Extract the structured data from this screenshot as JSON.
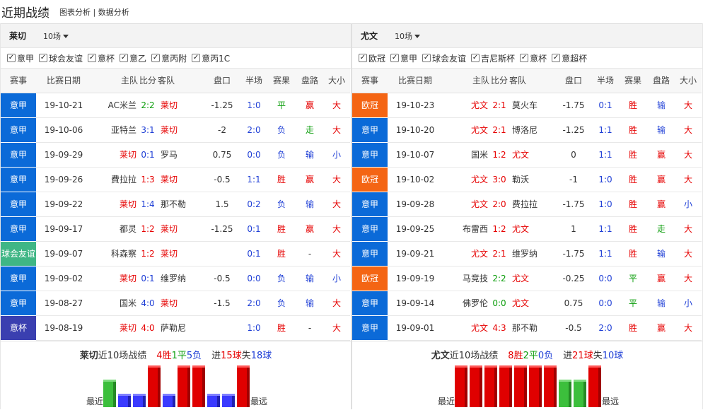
{
  "header": {
    "title": "近期战绩",
    "link1": "图表分析",
    "sep": "|",
    "link2": "数据分析"
  },
  "columns": [
    "赛事",
    "比赛日期",
    "主队",
    "比分",
    "客队",
    "盘口",
    "半场",
    "赛果",
    "盘路",
    "大小"
  ],
  "colors": {
    "league_serie_a": "#0b6ad8",
    "league_ucl": "#f46514",
    "league_friendly": "#3fb685",
    "league_cup": "#3a3fb0",
    "win": "#e60000",
    "draw": "#0a9d0a",
    "loss": "#1f3fd6"
  },
  "left": {
    "team": "莱切",
    "count": "10场",
    "filters": [
      "意甲",
      "球会友谊",
      "意杯",
      "意乙",
      "意丙附",
      "意丙1C"
    ],
    "rows": [
      {
        "league": "意甲",
        "lc": "sa",
        "date": "19-10-21",
        "home": "AC米兰",
        "hr": false,
        "score": "2:2",
        "sc": "g",
        "away": "莱切",
        "ar": true,
        "pk": "-1.25",
        "half": "1:0",
        "res": "平",
        "rc": "g",
        "pan": "赢",
        "pc": "r",
        "ou": "大",
        "oc": "r"
      },
      {
        "league": "意甲",
        "lc": "sa",
        "date": "19-10-06",
        "home": "亚特兰",
        "hr": false,
        "score": "3:1",
        "sc": "b",
        "away": "莱切",
        "ar": true,
        "pk": "-2",
        "half": "2:0",
        "res": "负",
        "rc": "b",
        "pan": "走",
        "pc": "g",
        "ou": "大",
        "oc": "r"
      },
      {
        "league": "意甲",
        "lc": "sa",
        "date": "19-09-29",
        "home": "莱切",
        "hr": true,
        "score": "0:1",
        "sc": "b",
        "away": "罗马",
        "ar": false,
        "pk": "0.75",
        "half": "0:0",
        "res": "负",
        "rc": "b",
        "pan": "输",
        "pc": "b",
        "ou": "小",
        "oc": "b"
      },
      {
        "league": "意甲",
        "lc": "sa",
        "date": "19-09-26",
        "home": "費拉拉",
        "hr": false,
        "score": "1:3",
        "sc": "r",
        "away": "莱切",
        "ar": true,
        "pk": "-0.5",
        "half": "1:1",
        "res": "胜",
        "rc": "r",
        "pan": "赢",
        "pc": "r",
        "ou": "大",
        "oc": "r"
      },
      {
        "league": "意甲",
        "lc": "sa",
        "date": "19-09-22",
        "home": "莱切",
        "hr": true,
        "score": "1:4",
        "sc": "b",
        "away": "那不勒",
        "ar": false,
        "pk": "1.5",
        "half": "0:2",
        "res": "负",
        "rc": "b",
        "pan": "输",
        "pc": "b",
        "ou": "大",
        "oc": "r"
      },
      {
        "league": "意甲",
        "lc": "sa",
        "date": "19-09-17",
        "home": "都灵",
        "hr": false,
        "score": "1:2",
        "sc": "r",
        "away": "莱切",
        "ar": true,
        "pk": "-1.25",
        "half": "0:1",
        "res": "胜",
        "rc": "r",
        "pan": "赢",
        "pc": "r",
        "ou": "大",
        "oc": "r"
      },
      {
        "league": "球会友谊",
        "lc": "fr",
        "date": "19-09-07",
        "home": "科森察",
        "hr": false,
        "score": "1:2",
        "sc": "r",
        "away": "莱切",
        "ar": true,
        "pk": "",
        "half": "0:1",
        "res": "胜",
        "rc": "r",
        "pan": "-",
        "pc": "n",
        "ou": "大",
        "oc": "r"
      },
      {
        "league": "意甲",
        "lc": "sa",
        "date": "19-09-02",
        "home": "莱切",
        "hr": true,
        "score": "0:1",
        "sc": "b",
        "away": "维罗纳",
        "ar": false,
        "pk": "-0.5",
        "half": "0:0",
        "res": "负",
        "rc": "b",
        "pan": "输",
        "pc": "b",
        "ou": "小",
        "oc": "b"
      },
      {
        "league": "意甲",
        "lc": "sa",
        "date": "19-08-27",
        "home": "国米",
        "hr": false,
        "score": "4:0",
        "sc": "b",
        "away": "莱切",
        "ar": true,
        "pk": "-1.5",
        "half": "2:0",
        "res": "负",
        "rc": "b",
        "pan": "输",
        "pc": "b",
        "ou": "大",
        "oc": "r"
      },
      {
        "league": "意杯",
        "lc": "cup",
        "date": "19-08-19",
        "home": "莱切",
        "hr": true,
        "score": "4:0",
        "sc": "r",
        "away": "萨勒尼",
        "ar": false,
        "pk": "",
        "half": "1:0",
        "res": "胜",
        "rc": "r",
        "pan": "-",
        "pc": "n",
        "ou": "大",
        "oc": "r"
      }
    ],
    "summary": {
      "team": "莱切",
      "label": "近10场战绩",
      "w": "4胜",
      "d": "1平",
      "l": "5负",
      "g1": "进",
      "gf": "15球",
      "g2": "失",
      "ga": "18球"
    },
    "form": [
      "d",
      "l",
      "l",
      "w",
      "l",
      "w",
      "w",
      "l",
      "l",
      "w"
    ],
    "recent": "最近",
    "far": "最远"
  },
  "right": {
    "team": "尤文",
    "count": "10场",
    "filters": [
      "欧冠",
      "意甲",
      "球会友谊",
      "吉尼斯杯",
      "意杯",
      "意超杯"
    ],
    "rows": [
      {
        "league": "欧冠",
        "lc": "ucl",
        "date": "19-10-23",
        "home": "尤文",
        "hr": true,
        "score": "2:1",
        "sc": "r",
        "away": "莫火车",
        "ar": false,
        "pk": "-1.75",
        "half": "0:1",
        "res": "胜",
        "rc": "r",
        "pan": "输",
        "pc": "b",
        "ou": "大",
        "oc": "r"
      },
      {
        "league": "意甲",
        "lc": "sa",
        "date": "19-10-20",
        "home": "尤文",
        "hr": true,
        "score": "2:1",
        "sc": "r",
        "away": "博洛尼",
        "ar": false,
        "pk": "-1.25",
        "half": "1:1",
        "res": "胜",
        "rc": "r",
        "pan": "输",
        "pc": "b",
        "ou": "大",
        "oc": "r"
      },
      {
        "league": "意甲",
        "lc": "sa",
        "date": "19-10-07",
        "home": "国米",
        "hr": false,
        "score": "1:2",
        "sc": "r",
        "away": "尤文",
        "ar": true,
        "pk": "0",
        "half": "1:1",
        "res": "胜",
        "rc": "r",
        "pan": "赢",
        "pc": "r",
        "ou": "大",
        "oc": "r"
      },
      {
        "league": "欧冠",
        "lc": "ucl",
        "date": "19-10-02",
        "home": "尤文",
        "hr": true,
        "score": "3:0",
        "sc": "r",
        "away": "勒沃",
        "ar": false,
        "pk": "-1",
        "half": "1:0",
        "res": "胜",
        "rc": "r",
        "pan": "赢",
        "pc": "r",
        "ou": "大",
        "oc": "r"
      },
      {
        "league": "意甲",
        "lc": "sa",
        "date": "19-09-28",
        "home": "尤文",
        "hr": true,
        "score": "2:0",
        "sc": "r",
        "away": "费拉拉",
        "ar": false,
        "pk": "-1.75",
        "half": "1:0",
        "res": "胜",
        "rc": "r",
        "pan": "赢",
        "pc": "r",
        "ou": "小",
        "oc": "b"
      },
      {
        "league": "意甲",
        "lc": "sa",
        "date": "19-09-25",
        "home": "布雷西",
        "hr": false,
        "score": "1:2",
        "sc": "r",
        "away": "尤文",
        "ar": true,
        "pk": "1",
        "half": "1:1",
        "res": "胜",
        "rc": "r",
        "pan": "走",
        "pc": "g",
        "ou": "大",
        "oc": "r"
      },
      {
        "league": "意甲",
        "lc": "sa",
        "date": "19-09-21",
        "home": "尤文",
        "hr": true,
        "score": "2:1",
        "sc": "r",
        "away": "维罗纳",
        "ar": false,
        "pk": "-1.75",
        "half": "1:1",
        "res": "胜",
        "rc": "r",
        "pan": "输",
        "pc": "b",
        "ou": "大",
        "oc": "r"
      },
      {
        "league": "欧冠",
        "lc": "ucl",
        "date": "19-09-19",
        "home": "马竞技",
        "hr": false,
        "score": "2:2",
        "sc": "g",
        "away": "尤文",
        "ar": true,
        "pk": "-0.25",
        "half": "0:0",
        "res": "平",
        "rc": "g",
        "pan": "赢",
        "pc": "r",
        "ou": "大",
        "oc": "r"
      },
      {
        "league": "意甲",
        "lc": "sa",
        "date": "19-09-14",
        "home": "佛罗伦",
        "hr": false,
        "score": "0:0",
        "sc": "g",
        "away": "尤文",
        "ar": true,
        "pk": "0.75",
        "half": "0:0",
        "res": "平",
        "rc": "g",
        "pan": "输",
        "pc": "b",
        "ou": "小",
        "oc": "b"
      },
      {
        "league": "意甲",
        "lc": "sa",
        "date": "19-09-01",
        "home": "尤文",
        "hr": true,
        "score": "4:3",
        "sc": "r",
        "away": "那不勒",
        "ar": false,
        "pk": "-0.5",
        "half": "2:0",
        "res": "胜",
        "rc": "r",
        "pan": "赢",
        "pc": "r",
        "ou": "大",
        "oc": "r"
      }
    ],
    "summary": {
      "team": "尤文",
      "label": "近10场战绩",
      "w": "8胜",
      "d": "2平",
      "l": "0负",
      "g1": "进",
      "gf": "21球",
      "g2": "失",
      "ga": "10球"
    },
    "form": [
      "w",
      "w",
      "w",
      "w",
      "w",
      "w",
      "w",
      "d",
      "d",
      "w"
    ],
    "recent": "最近",
    "far": "最远"
  }
}
